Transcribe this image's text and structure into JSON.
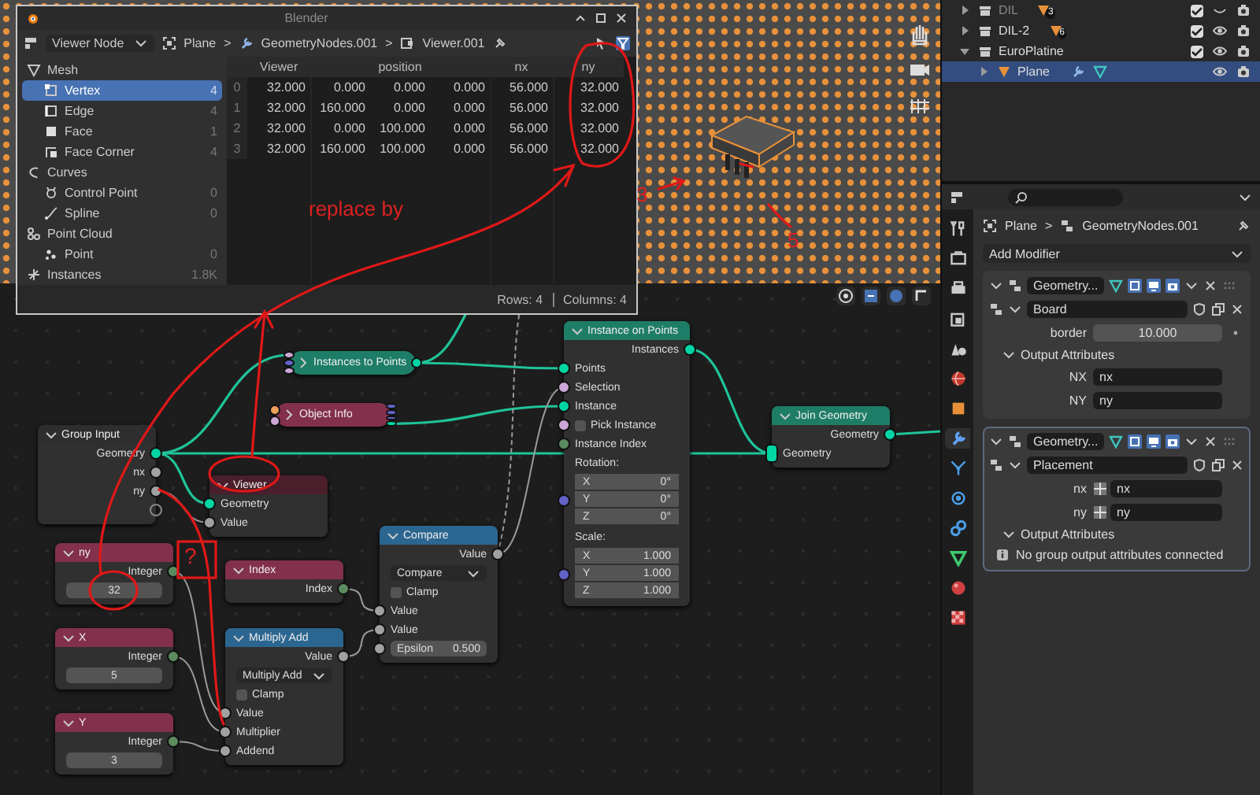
{
  "spreadsheet": {
    "title": "Blender",
    "mode": "Viewer Node",
    "breadcrumb": [
      {
        "kind": "object",
        "label": "Plane"
      },
      {
        "kind": "separator",
        "label": ">"
      },
      {
        "kind": "modifier",
        "label": "GeometryNodes.001"
      },
      {
        "kind": "separator",
        "label": ">"
      },
      {
        "kind": "viewer",
        "label": "Viewer.001"
      }
    ],
    "domains": [
      {
        "kind": "mesh",
        "label": "Mesh",
        "children": [
          {
            "kind": "vertex",
            "label": "Vertex",
            "count": "4",
            "selected": true
          },
          {
            "kind": "edge",
            "label": "Edge",
            "count": "4",
            "selected": false
          },
          {
            "kind": "face",
            "label": "Face",
            "count": "1",
            "selected": false
          },
          {
            "kind": "face-corner",
            "label": "Face Corner",
            "count": "4",
            "selected": false
          }
        ]
      },
      {
        "kind": "curves",
        "label": "Curves",
        "children": [
          {
            "kind": "control-point",
            "label": "Control Point",
            "count": "0",
            "selected": false
          },
          {
            "kind": "spline",
            "label": "Spline",
            "count": "0",
            "selected": false
          }
        ]
      },
      {
        "kind": "point-cloud",
        "label": "Point Cloud",
        "children": [
          {
            "kind": "point",
            "label": "Point",
            "count": "0",
            "selected": false
          }
        ]
      },
      {
        "kind": "instances",
        "label": "Instances",
        "count": "1.8K",
        "selected": false
      }
    ],
    "columns": [
      {
        "label": "Viewer",
        "kind": "scalar"
      },
      {
        "label": "position",
        "kind": "vector"
      },
      {
        "label": "nx",
        "kind": "scalar"
      },
      {
        "label": "ny",
        "kind": "scalar"
      }
    ],
    "rows": [
      {
        "index": "0",
        "cells": [
          "32.000",
          [
            "0.000",
            "0.000",
            "0.000"
          ],
          "56.000",
          "32.000"
        ]
      },
      {
        "index": "1",
        "cells": [
          "32.000",
          [
            "160.000",
            "0.000",
            "0.000"
          ],
          "56.000",
          "32.000"
        ]
      },
      {
        "index": "2",
        "cells": [
          "32.000",
          [
            "0.000",
            "100.000",
            "0.000"
          ],
          "56.000",
          "32.000"
        ]
      },
      {
        "index": "3",
        "cells": [
          "32.000",
          [
            "160.000",
            "100.000",
            "0.000"
          ],
          "56.000",
          "32.000"
        ]
      }
    ],
    "status": {
      "rows": "Rows: 4",
      "columns": "Columns: 4"
    }
  },
  "outliner": {
    "items": [
      {
        "kind": "collection",
        "label": "DIL",
        "badge": "3",
        "checked": true,
        "visible": false,
        "expanded": false,
        "selected": false
      },
      {
        "kind": "collection",
        "label": "DIL-2",
        "badge": "6",
        "checked": true,
        "visible": true,
        "expanded": false,
        "selected": false
      },
      {
        "kind": "collection",
        "label": "EuroPlatine",
        "checked": true,
        "visible": true,
        "expanded": true,
        "selected": false,
        "children": [
          {
            "kind": "object",
            "label": "Plane",
            "visible": true,
            "expanded": false,
            "selected": true
          }
        ]
      }
    ]
  },
  "properties": {
    "tabs": [
      {
        "kind": "tool",
        "selected": false
      },
      {
        "kind": "render",
        "selected": false
      },
      {
        "kind": "output",
        "selected": false
      },
      {
        "kind": "view-layer",
        "selected": false
      },
      {
        "kind": "scene",
        "selected": false
      },
      {
        "kind": "world",
        "selected": false
      },
      {
        "kind": "object",
        "selected": false
      },
      {
        "kind": "modifier",
        "selected": true
      },
      {
        "kind": "particles",
        "selected": false
      },
      {
        "kind": "physics",
        "selected": false
      },
      {
        "kind": "constraints",
        "selected": false
      },
      {
        "kind": "data",
        "selected": false
      },
      {
        "kind": "material",
        "selected": false
      },
      {
        "kind": "texture",
        "selected": false
      }
    ],
    "breadcrumb": [
      {
        "kind": "object",
        "label": "Plane"
      },
      {
        "kind": "separator",
        "label": ">"
      },
      {
        "kind": "modifier",
        "label": "GeometryNodes.001"
      }
    ],
    "add_modifier": "Add Modifier",
    "modifiers": [
      {
        "name": "Geometry...",
        "active": false,
        "expanded": true,
        "group": "Board",
        "inputs": [
          {
            "kind": "number",
            "label": "border",
            "value": "10.000"
          }
        ],
        "outputs_title": "Output Attributes",
        "outputs_expanded": true,
        "outputs": [
          {
            "label": "NX",
            "value": "nx"
          },
          {
            "label": "NY",
            "value": "ny"
          }
        ]
      },
      {
        "name": "Geometry...",
        "active": true,
        "expanded": true,
        "group": "Placement",
        "inputs": [
          {
            "kind": "attribute",
            "label": "nx",
            "value": "nx"
          },
          {
            "kind": "attribute",
            "label": "ny",
            "value": "ny"
          }
        ],
        "outputs_title": "Output Attributes",
        "outputs_expanded": true,
        "note": "No group output attributes connected"
      }
    ]
  },
  "nodes": [
    {
      "title": "Group Input",
      "collapsed": false,
      "color": "#2e2e2e",
      "rows": [
        {
          "kind": "output",
          "label": "Geometry",
          "color": "#00d6a3"
        },
        {
          "kind": "output",
          "label": "nx",
          "color": "#a1a1a1"
        },
        {
          "kind": "output",
          "label": "ny",
          "color": "#a1a1a1"
        },
        {
          "kind": "virtual-output"
        }
      ]
    },
    {
      "title": "Viewer",
      "collapsed": false,
      "color": "#4a1e2a",
      "rows": [
        {
          "kind": "input",
          "label": "Geometry",
          "color": "#00d6a3"
        },
        {
          "kind": "input",
          "label": "Value",
          "color": "#a1a1a1"
        }
      ]
    },
    {
      "title": "Instances to Points",
      "collapsed": true,
      "color": "#1e7d66",
      "in_sockets": [
        {
          "color": "#cca6d6"
        },
        {
          "color": "#6363c7"
        },
        {
          "color": "#cca6d6"
        }
      ],
      "out_sockets": [
        {
          "color": "#00d6a3"
        }
      ]
    },
    {
      "title": "Object Info",
      "collapsed": true,
      "color": "#83304d",
      "in_sockets": [
        {
          "color": "#ed9e5c"
        },
        {
          "color": "#cca6d6"
        }
      ],
      "out_sockets": [
        {
          "color": "#6363c7"
        },
        {
          "color": "#6363c7"
        },
        {
          "color": "#6363c7"
        },
        {
          "color": "#00d6a3"
        }
      ]
    },
    {
      "title": "Instance on Points",
      "collapsed": false,
      "color": "#1e7d66",
      "rows": [
        {
          "kind": "output",
          "label": "Instances",
          "color": "#00d6a3"
        },
        {
          "kind": "input",
          "label": "Points",
          "color": "#00d6a3"
        },
        {
          "kind": "input",
          "label": "Selection",
          "color": "#cca6d6"
        },
        {
          "kind": "input",
          "label": "Instance",
          "color": "#00d6a3"
        },
        {
          "kind": "checkbox",
          "label": "Pick Instance",
          "checked": false,
          "color": "#cca6d6"
        },
        {
          "kind": "input",
          "label": "Instance Index",
          "color": "#5b8c5f"
        },
        {
          "kind": "label",
          "label": "Rotation:"
        },
        {
          "kind": "vector",
          "color": "#6363c7",
          "components": [
            {
              "axis": "X",
              "value": "0°"
            },
            {
              "axis": "Y",
              "value": "0°"
            },
            {
              "axis": "Z",
              "value": "0°"
            }
          ]
        },
        {
          "kind": "label",
          "label": "Scale:"
        },
        {
          "kind": "vector",
          "color": "#6363c7",
          "components": [
            {
              "axis": "X",
              "value": "1.000"
            },
            {
              "axis": "Y",
              "value": "1.000"
            },
            {
              "axis": "Z",
              "value": "1.000"
            }
          ]
        }
      ]
    },
    {
      "title": "Join Geometry",
      "collapsed": false,
      "color": "#1e7d66",
      "rows": [
        {
          "kind": "output",
          "label": "Geometry",
          "color": "#00d6a3"
        },
        {
          "kind": "multi-input",
          "label": "Geometry",
          "color": "#00d6a3"
        }
      ]
    },
    {
      "title": "ny",
      "collapsed": false,
      "color": "#83304d",
      "rows": [
        {
          "kind": "output",
          "label": "Integer",
          "color": "#5b8c5f"
        },
        {
          "kind": "field",
          "value": "32"
        }
      ]
    },
    {
      "title": "X",
      "collapsed": false,
      "color": "#83304d",
      "rows": [
        {
          "kind": "output",
          "label": "Integer",
          "color": "#5b8c5f"
        },
        {
          "kind": "field",
          "value": "5"
        }
      ]
    },
    {
      "title": "Y",
      "collapsed": false,
      "color": "#83304d",
      "rows": [
        {
          "kind": "output",
          "label": "Integer",
          "color": "#5b8c5f"
        },
        {
          "kind": "field",
          "value": "3"
        }
      ]
    },
    {
      "title": "Index",
      "collapsed": false,
      "color": "#83304d",
      "rows": [
        {
          "kind": "output",
          "label": "Index",
          "color": "#5b8c5f"
        }
      ]
    },
    {
      "title": "Multiply Add",
      "collapsed": false,
      "color": "#2b6690",
      "rows": [
        {
          "kind": "output",
          "label": "Value",
          "color": "#a1a1a1"
        },
        {
          "kind": "dropdown",
          "value": "Multiply Add"
        },
        {
          "kind": "checkbox",
          "label": "Clamp",
          "checked": false
        },
        {
          "kind": "input",
          "label": "Value",
          "color": "#a1a1a1"
        },
        {
          "kind": "input",
          "label": "Multiplier",
          "color": "#a1a1a1"
        },
        {
          "kind": "input",
          "label": "Addend",
          "color": "#a1a1a1"
        }
      ]
    },
    {
      "title": "Compare",
      "collapsed": false,
      "color": "#2b6690",
      "rows": [
        {
          "kind": "output",
          "label": "Value",
          "color": "#a1a1a1"
        },
        {
          "kind": "dropdown",
          "value": "Compare"
        },
        {
          "kind": "checkbox",
          "label": "Clamp",
          "checked": false
        },
        {
          "kind": "input",
          "label": "Value",
          "color": "#a1a1a1"
        },
        {
          "kind": "input",
          "label": "Value",
          "color": "#a1a1a1"
        },
        {
          "kind": "field",
          "label": "Epsilon",
          "value": "0.500",
          "color": "#a1a1a1"
        }
      ]
    }
  ],
  "annotations": [
    {
      "text": "replace by"
    },
    {
      "text": "3"
    },
    {
      "text": "5"
    },
    {
      "text": "?"
    }
  ]
}
